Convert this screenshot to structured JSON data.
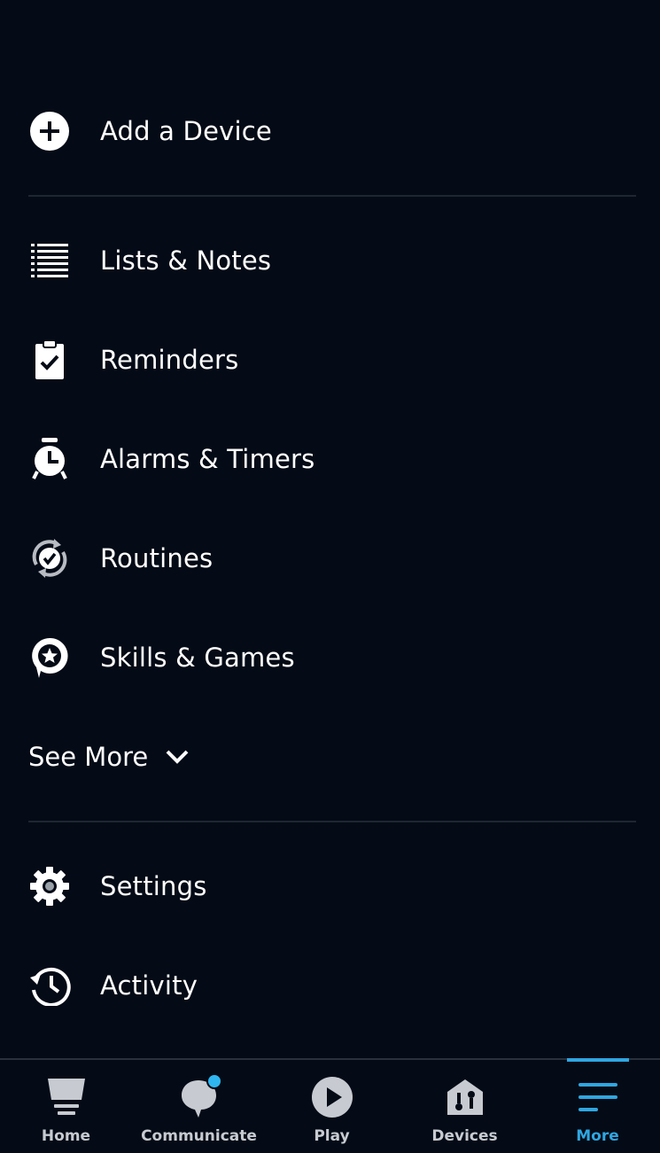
{
  "menu": {
    "add_device": "Add a Device",
    "lists_notes": "Lists & Notes",
    "reminders": "Reminders",
    "alarms_timers": "Alarms & Timers",
    "routines": "Routines",
    "skills_games": "Skills & Games",
    "see_more": "See More",
    "settings": "Settings",
    "activity": "Activity"
  },
  "icons": {
    "add_device": "plus-circle-icon",
    "lists_notes": "list-icon",
    "reminders": "clipboard-check-icon",
    "alarms_timers": "alarm-clock-icon",
    "routines": "routine-cycle-check-icon",
    "skills_games": "speech-bubble-star-icon",
    "see_more": "chevron-down-icon",
    "settings": "gear-icon",
    "activity": "history-clock-icon"
  },
  "bottom_nav": {
    "items": [
      {
        "label": "Home",
        "icon": "home-cup-icon"
      },
      {
        "label": "Communicate",
        "icon": "chat-bubble-icon"
      },
      {
        "label": "Play",
        "icon": "play-icon"
      },
      {
        "label": "Devices",
        "icon": "devices-house-icon"
      },
      {
        "label": "More",
        "icon": "hamburger-menu-icon"
      }
    ],
    "active": "More"
  },
  "colors": {
    "background": "#040b16",
    "accent": "#2fa6e1",
    "text": "#ffffff",
    "nav_inactive": "#c7cbd1",
    "divider": "#1e2632"
  }
}
